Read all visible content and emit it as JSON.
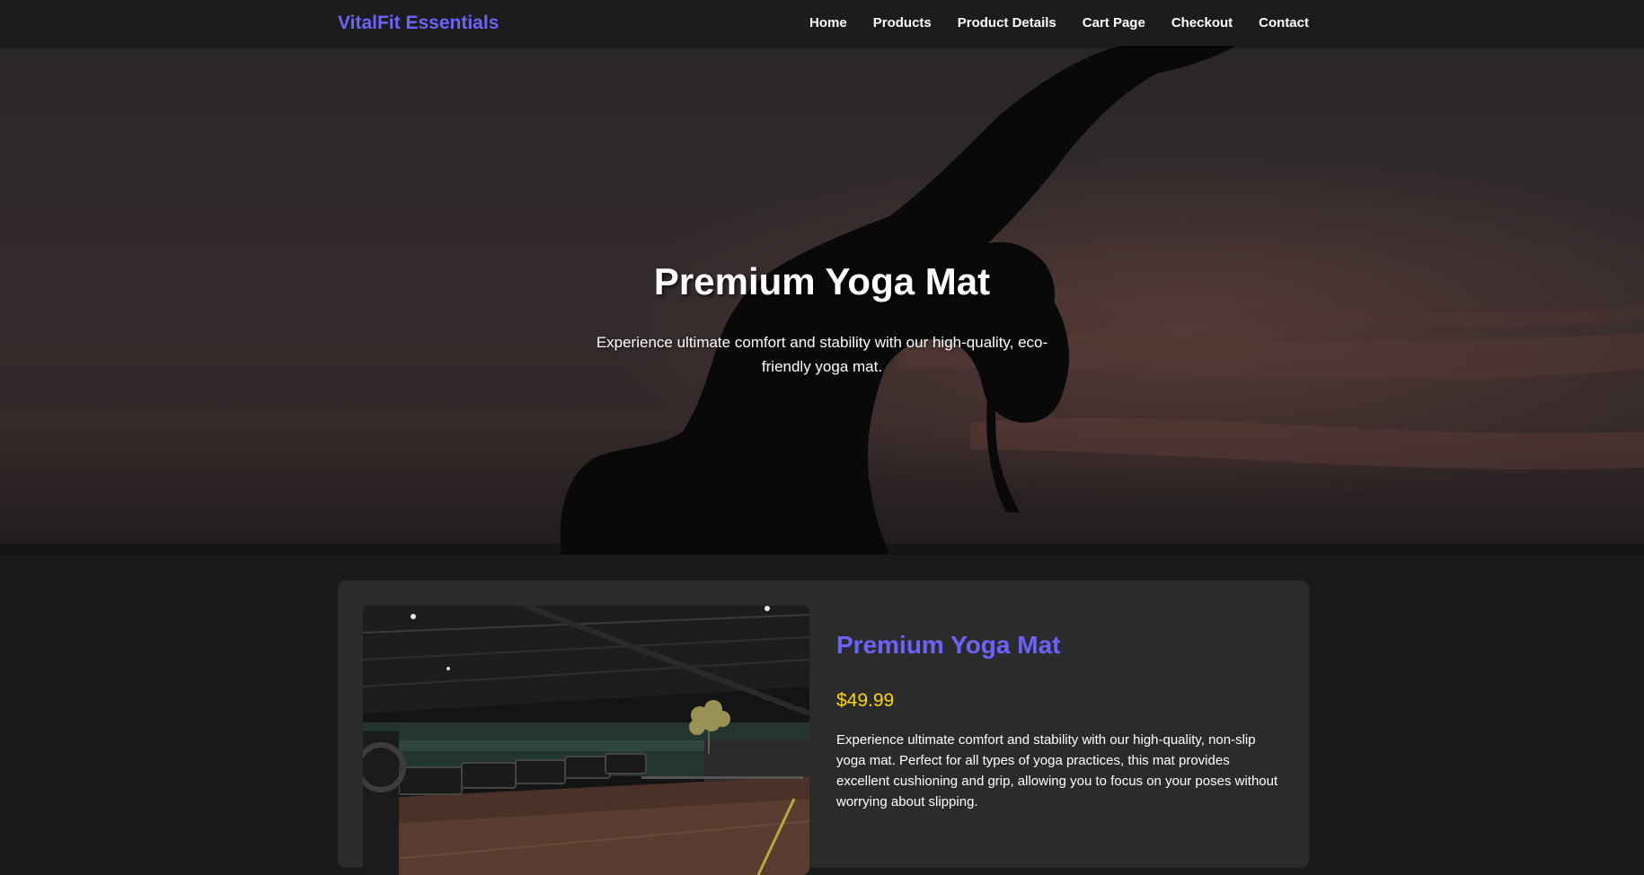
{
  "nav": {
    "brand": "VitalFit Essentials",
    "links": [
      "Home",
      "Products",
      "Product Details",
      "Cart Page",
      "Checkout",
      "Contact"
    ]
  },
  "hero": {
    "title": "Premium Yoga Mat",
    "subtitle": "Experience ultimate comfort and stability with our high-quality, eco-friendly yoga mat."
  },
  "product": {
    "title": "Premium Yoga Mat",
    "price": "$49.99",
    "description": "Experience ultimate comfort and stability with our high-quality, non-slip yoga mat. Perfect for all types of yoga practices, this mat provides excellent cushioning and grip, allowing you to focus on your poses without worrying about slipping."
  },
  "colors": {
    "accent": "#6c63ff",
    "price": "#ffd700",
    "background": "#1a1a1a",
    "card": "#2b2b2b"
  }
}
